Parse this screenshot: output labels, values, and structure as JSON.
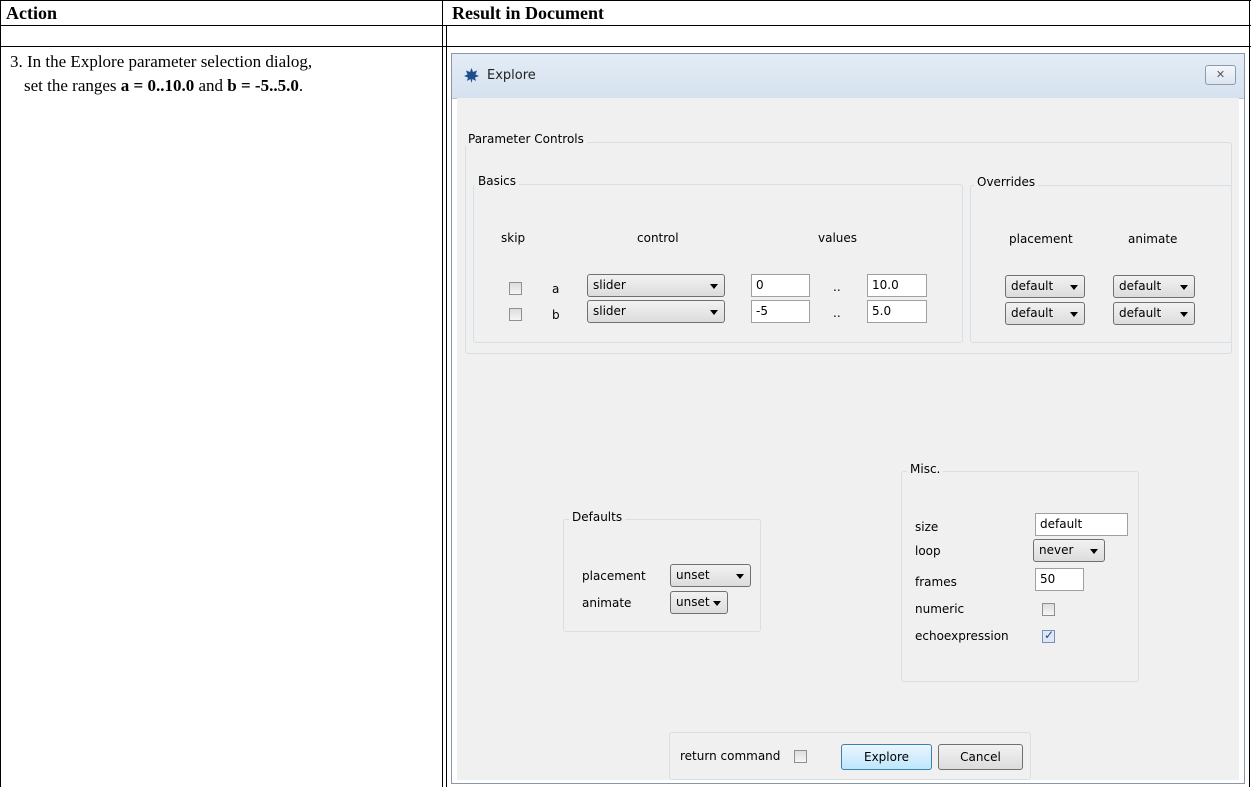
{
  "table": {
    "header_action": "Action",
    "header_result": "Result in Document",
    "step_number": "3.",
    "step_text_1": "In the Explore parameter selection dialog,",
    "step_text_2a": "set the ranges ",
    "step_a_range": "a = 0..10.0",
    "step_and": " and ",
    "step_b_range": "b = -5..5.0",
    "step_end": "."
  },
  "dialog": {
    "title": "Explore",
    "close_glyph": "✕",
    "parameter_controls": {
      "label": "Parameter Controls",
      "basics": {
        "label": "Basics",
        "col_skip": "skip",
        "col_control": "control",
        "col_values": "values",
        "rows": [
          {
            "name": "a",
            "skip": false,
            "control": "slider",
            "from": "0",
            "dots": "..",
            "to": "10.0"
          },
          {
            "name": "b",
            "skip": false,
            "control": "slider",
            "from": "-5",
            "dots": "..",
            "to": "5.0"
          }
        ]
      },
      "overrides": {
        "label": "Overrides",
        "col_placement": "placement",
        "col_animate": "animate",
        "rows": [
          {
            "placement": "default",
            "animate": "default"
          },
          {
            "placement": "default",
            "animate": "default"
          }
        ]
      }
    },
    "defaults": {
      "label": "Defaults",
      "placement_label": "placement",
      "placement_value": "unset",
      "animate_label": "animate",
      "animate_value": "unset"
    },
    "misc": {
      "label": "Misc.",
      "size_label": "size",
      "size_value": "default",
      "loop_label": "loop",
      "loop_value": "never",
      "frames_label": "frames",
      "frames_value": "50",
      "numeric_label": "numeric",
      "numeric_checked": false,
      "echo_label": "echoexpression",
      "echo_checked": true
    },
    "bottom": {
      "return_label": "return command",
      "return_checked": false,
      "explore_button": "Explore",
      "cancel_button": "Cancel"
    }
  },
  "colors": {
    "accent": "#3c7fb1",
    "icon": "#1f4e8c"
  }
}
